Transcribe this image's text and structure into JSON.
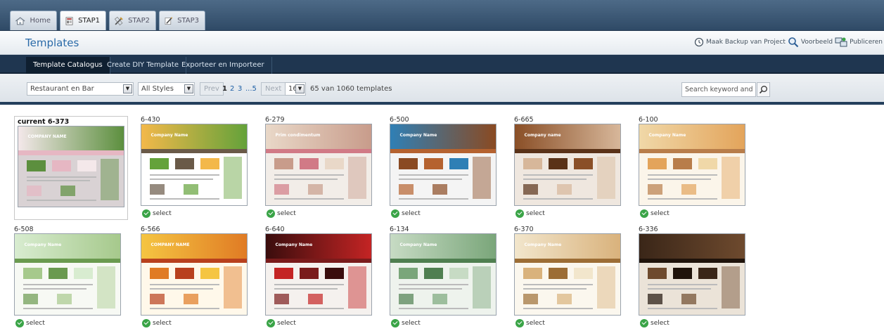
{
  "top_tabs": [
    {
      "label": "Home",
      "icon": "home-icon"
    },
    {
      "label": "STAP1",
      "icon": "layout-document-icon"
    },
    {
      "label": "STAP2",
      "icon": "brush-icon"
    },
    {
      "label": "STAP3",
      "icon": "pencil-icon"
    }
  ],
  "page_title": "Templates",
  "actions": {
    "backup": "Maak Backup van Project",
    "preview": "Voorbeeld",
    "publish": "Publiceren"
  },
  "sub_tabs": [
    "Template Catalogus",
    "Create DIY Template",
    "Exporteer en Importeer"
  ],
  "filters": {
    "category": "Restaurant en Bar",
    "style": "All Styles",
    "prev": "Prev",
    "pages": [
      "1",
      "2",
      "3",
      "...5"
    ],
    "next": "Next",
    "per_page": "16",
    "result_count": "65 van 1060 templates",
    "search_placeholder": "Search keyword and ID"
  },
  "select_label": "select",
  "templates": [
    {
      "id": "current 6-373",
      "current": true,
      "palette": [
        "#f4e8ea",
        "#5c8f3e",
        "#d9d2d4",
        "#e6b7c3"
      ],
      "logo": "COMPANY NAME"
    },
    {
      "id": "6-430",
      "palette": [
        "#f3b84a",
        "#64a23a",
        "#ffffff",
        "#6a5a48"
      ],
      "logo": "Company Name"
    },
    {
      "id": "6-279",
      "palette": [
        "#e9d8c8",
        "#c89c8b",
        "#f2ede8",
        "#d17a86"
      ],
      "logo": "Prim condimentum"
    },
    {
      "id": "6-500",
      "palette": [
        "#2f7fb5",
        "#8a4a22",
        "#f4f4f4",
        "#b5622f"
      ],
      "logo": "Company Name"
    },
    {
      "id": "6-665",
      "palette": [
        "#8a4f27",
        "#d7b79a",
        "#efe7df",
        "#5a3218"
      ],
      "logo": "Company name"
    },
    {
      "id": "6-100",
      "palette": [
        "#f0d8a8",
        "#e3a45b",
        "#fbf5ea",
        "#b87d4a"
      ],
      "logo": "Company Name"
    },
    {
      "id": "6-508",
      "palette": [
        "#d8ecd0",
        "#a6c98c",
        "#f7f9f4",
        "#6a9a4f"
      ],
      "logo": "Company Name"
    },
    {
      "id": "6-566",
      "palette": [
        "#f5c542",
        "#e07b24",
        "#fff8ea",
        "#b8401d"
      ],
      "logo": "COMPANY NAME"
    },
    {
      "id": "6-640",
      "palette": [
        "#3a0d0d",
        "#c42424",
        "#f5f1ee",
        "#7a1b1b"
      ],
      "logo": "Company Name"
    },
    {
      "id": "6-134",
      "palette": [
        "#c7dbc4",
        "#7aa67a",
        "#eef3ed",
        "#4f7f50"
      ],
      "logo": "Company Name"
    },
    {
      "id": "6-370",
      "palette": [
        "#f2e6cc",
        "#d9b27c",
        "#fbf7ee",
        "#9c6d35"
      ],
      "logo": "Company Name"
    },
    {
      "id": "6-336",
      "palette": [
        "#3a2618",
        "#6e4a2e",
        "#ebe3d8",
        "#1f130b"
      ],
      "logo": ""
    }
  ]
}
